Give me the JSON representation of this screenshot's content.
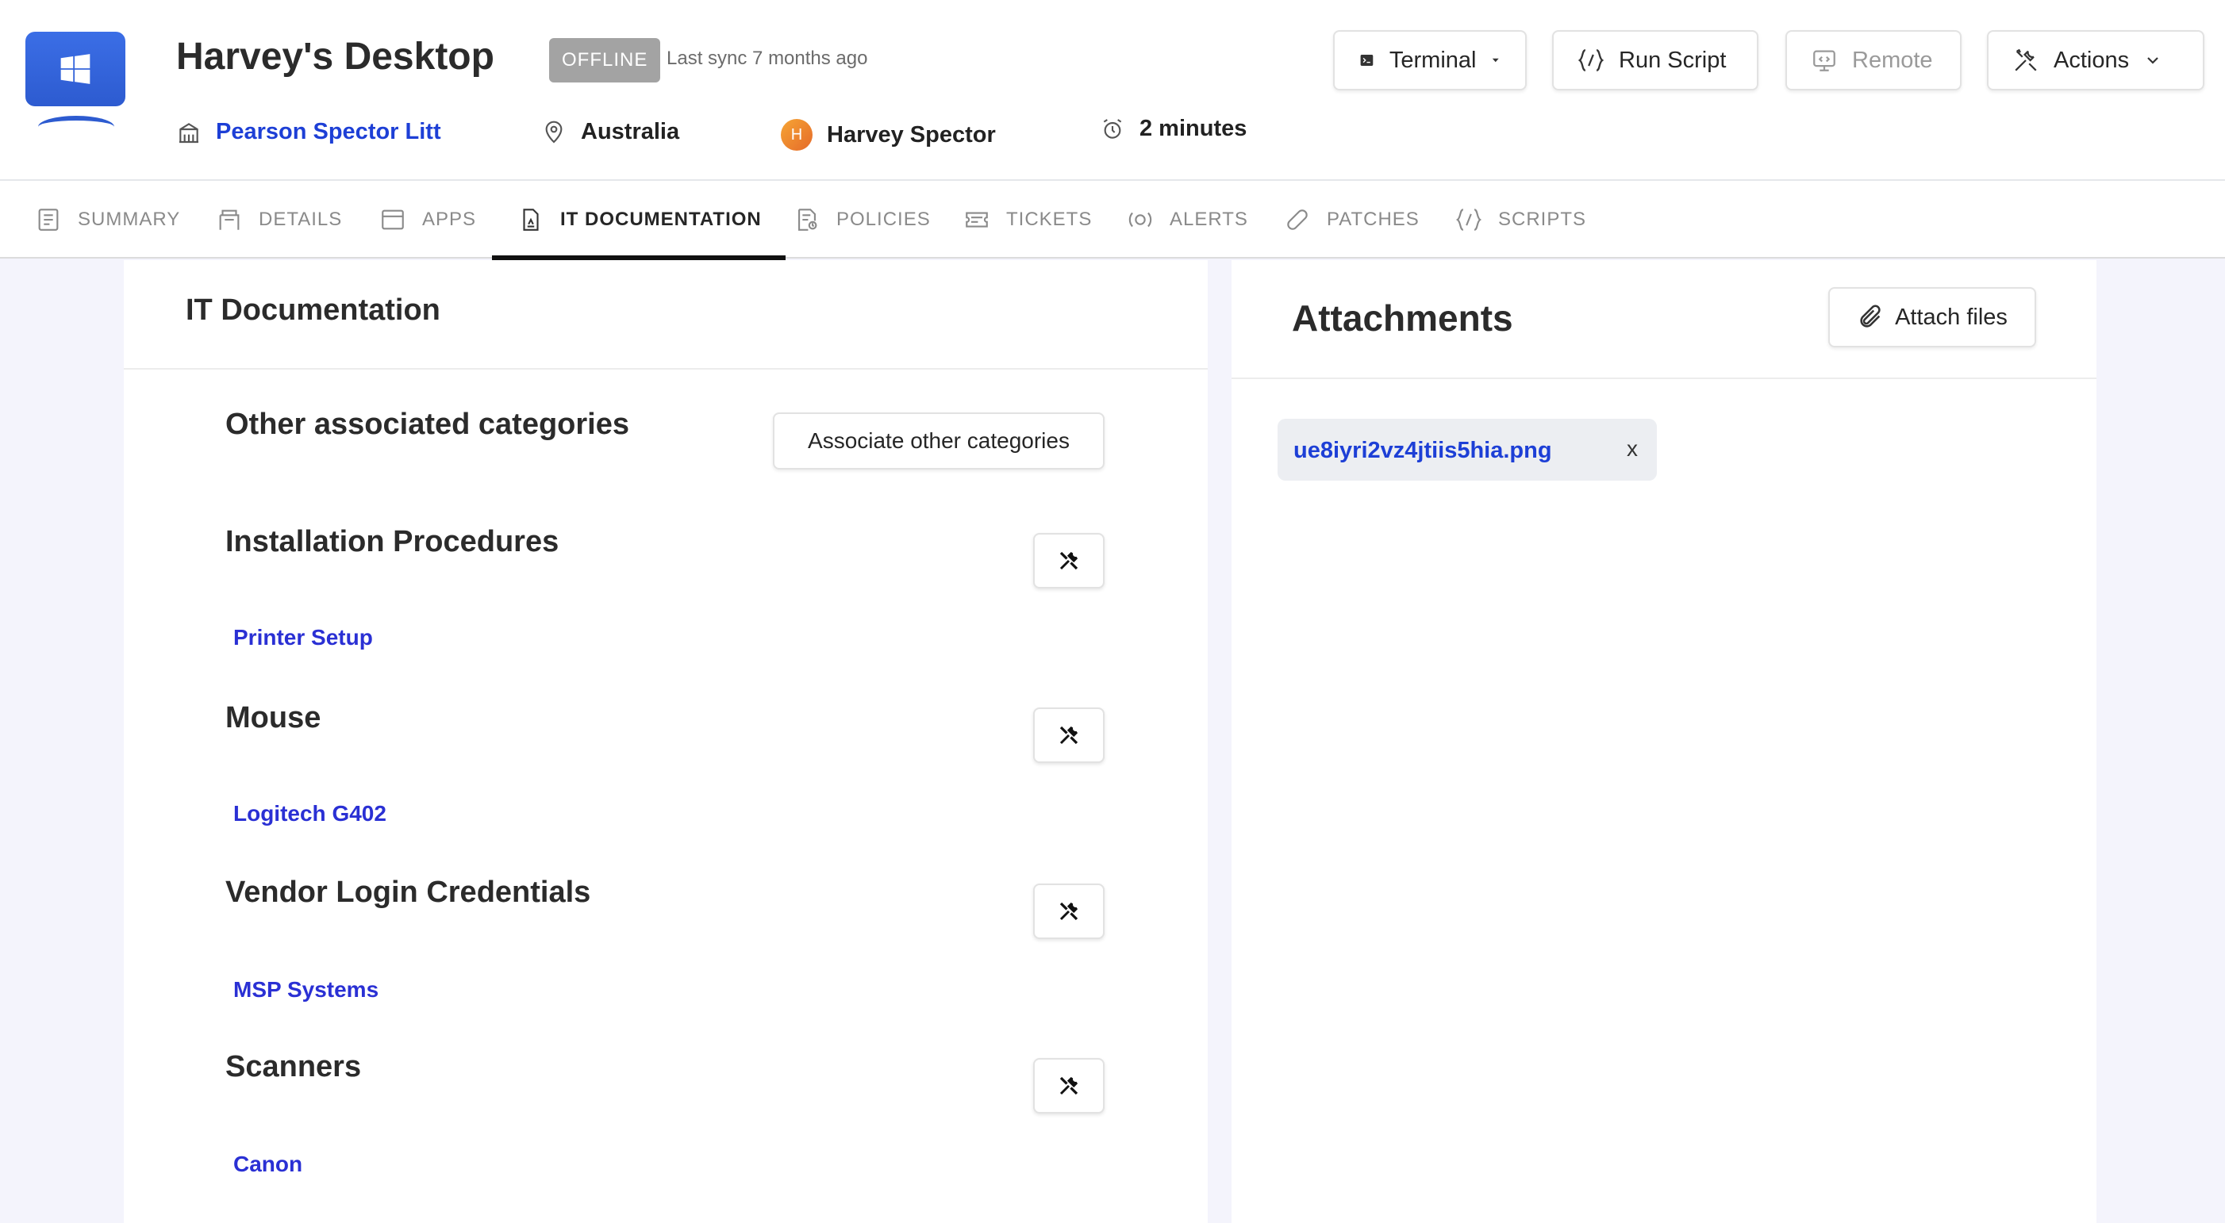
{
  "device": {
    "title": "Harvey's Desktop",
    "status": "OFFLINE",
    "last_sync": "Last sync 7 months ago",
    "organization": "Pearson Spector Litt",
    "country": "Australia",
    "user_initial": "H",
    "user": "Harvey Spector",
    "uptime": "2 minutes"
  },
  "toolbar": {
    "terminal_label": "Terminal",
    "run_script_label": "Run Script",
    "remote_label": "Remote",
    "actions_label": "Actions"
  },
  "tabs": [
    {
      "label": "SUMMARY",
      "icon": "summary-icon"
    },
    {
      "label": "DETAILS",
      "icon": "details-icon"
    },
    {
      "label": "APPS",
      "icon": "apps-icon"
    },
    {
      "label": "IT DOCUMENTATION",
      "icon": "document-icon",
      "active": true
    },
    {
      "label": "POLICIES",
      "icon": "policies-icon"
    },
    {
      "label": "TICKETS",
      "icon": "ticket-icon"
    },
    {
      "label": "ALERTS",
      "icon": "alert-icon"
    },
    {
      "label": "PATCHES",
      "icon": "bandage-icon"
    },
    {
      "label": "SCRIPTS",
      "icon": "script-icon"
    }
  ],
  "documentation": {
    "title": "IT Documentation",
    "other_categories_title": "Other associated categories",
    "associate_button": "Associate other categories",
    "categories": [
      {
        "title": "Installation Procedures",
        "item": "Printer Setup"
      },
      {
        "title": "Mouse",
        "item": "Logitech G402"
      },
      {
        "title": "Vendor Login Credentials",
        "item": "MSP Systems"
      },
      {
        "title": "Scanners",
        "item": "Canon"
      }
    ]
  },
  "attachments": {
    "title": "Attachments",
    "attach_button": "Attach files",
    "files": [
      {
        "name": "ue8iyri2vz4jtiis5hia.png",
        "remove_label": "x"
      }
    ]
  },
  "colors": {
    "link": "#2a30d4",
    "brand_blue": "#2d5bd0",
    "offline_badge": "#a3a3a3"
  }
}
